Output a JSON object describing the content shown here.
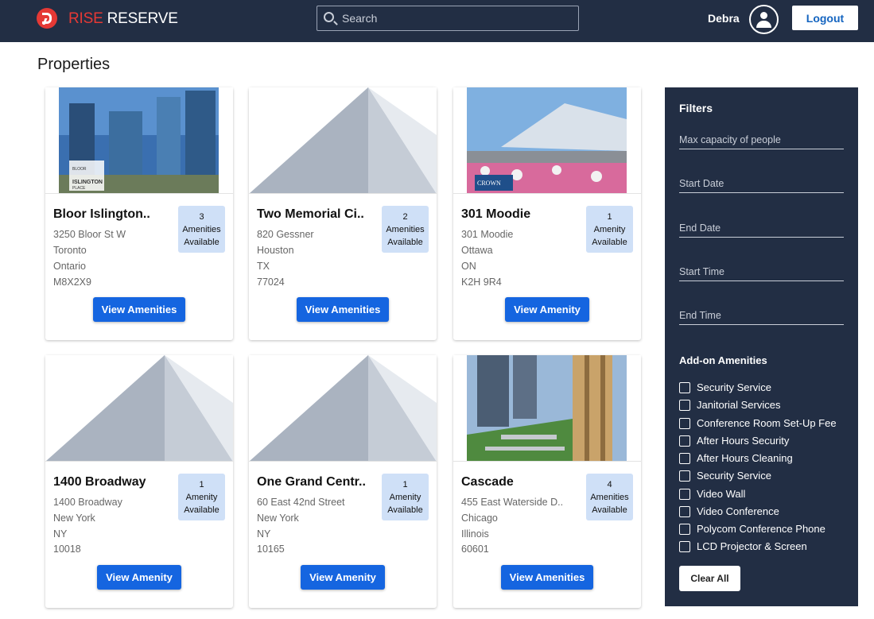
{
  "header": {
    "brand_rise": "RISE",
    "brand_reserve": "RESERVE",
    "search_placeholder": "Search",
    "username": "Debra",
    "logout_label": "Logout"
  },
  "page_title": "Properties",
  "properties": [
    {
      "name": "Bloor Islington..",
      "address": "3250 Bloor St W",
      "city": "Toronto",
      "region": "Ontario",
      "postal": "M8X2X9",
      "amenity_count": "3",
      "amenity_word": "Amenities",
      "available": "Available",
      "button": "View Amenities",
      "image_caption": "BLOOR ISLINGTON PLACE"
    },
    {
      "name": "Two Memorial Ci..",
      "address": "820 Gessner",
      "city": "Houston",
      "region": "TX",
      "postal": "77024",
      "amenity_count": "2",
      "amenity_word": "Amenities",
      "available": "Available",
      "button": "View Amenities"
    },
    {
      "name": "301 Moodie",
      "address": "301 Moodie",
      "city": "Ottawa",
      "region": "ON",
      "postal": "K2H 9R4",
      "amenity_count": "1",
      "amenity_word": "Amenity",
      "available": "Available",
      "button": "View Amenity",
      "image_caption": "CROWN"
    },
    {
      "name": "1400 Broadway",
      "address": "1400 Broadway",
      "city": "New York",
      "region": "NY",
      "postal": "10018",
      "amenity_count": "1",
      "amenity_word": "Amenity",
      "available": "Available",
      "button": "View Amenity"
    },
    {
      "name": "One Grand Centr..",
      "address": "60 East 42nd Street",
      "city": "New York",
      "region": "NY",
      "postal": "10165",
      "amenity_count": "1",
      "amenity_word": "Amenity",
      "available": "Available",
      "button": "View Amenity"
    },
    {
      "name": "Cascade",
      "address": "455 East Waterside D..",
      "city": "Chicago",
      "region": "Illinois",
      "postal": "60601",
      "amenity_count": "4",
      "amenity_word": "Amenities",
      "available": "Available",
      "button": "View Amenities"
    }
  ],
  "filters": {
    "title": "Filters",
    "fields": [
      "Max capacity of people",
      "Start Date",
      "End Date",
      "Start Time",
      "End Time"
    ],
    "addons_title": "Add-on Amenities",
    "addons": [
      "Security Service",
      "Janitorial Services",
      "Conference Room Set-Up Fee",
      "After Hours Security",
      "After Hours Cleaning",
      "Security Service",
      "Video Wall",
      "Video Conference",
      "Polycom Conference Phone",
      "LCD Projector & Screen"
    ],
    "clear_label": "Clear All"
  }
}
